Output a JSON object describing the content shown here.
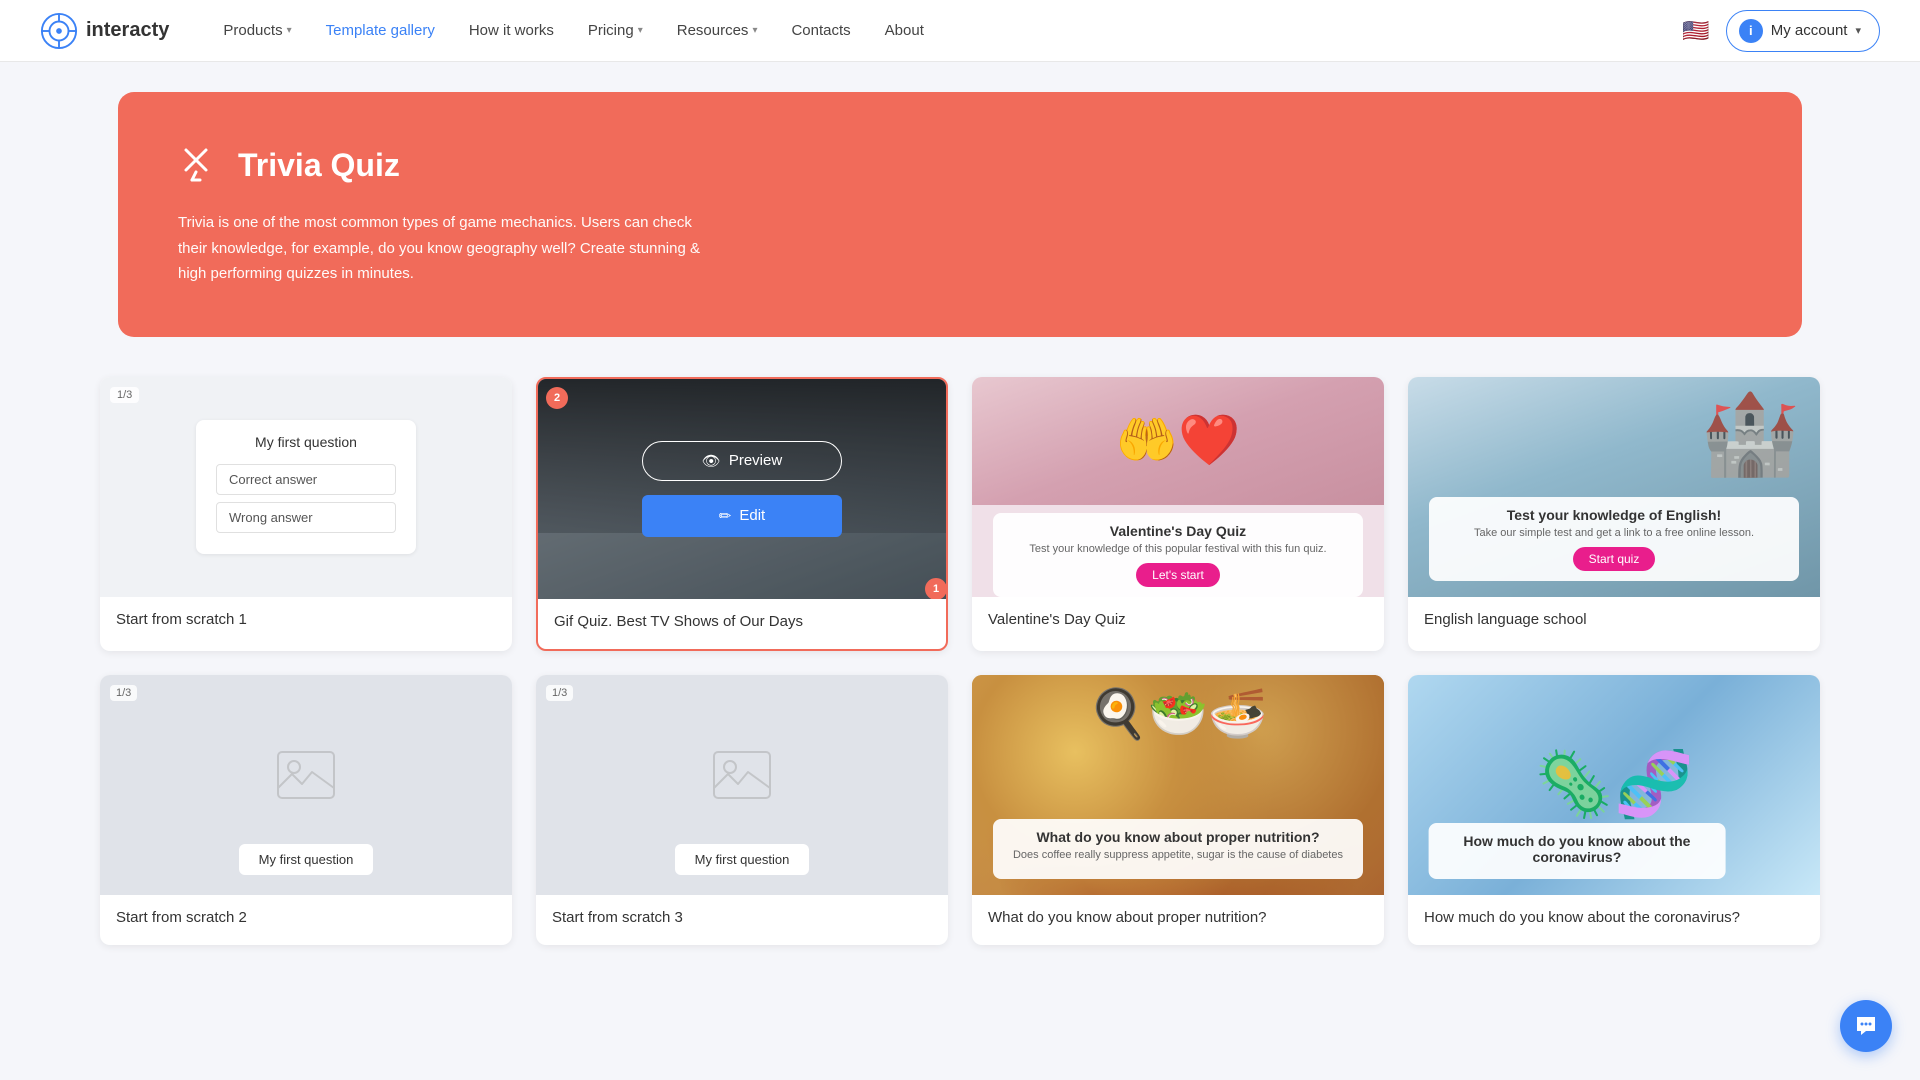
{
  "nav": {
    "logo_text": "interacty",
    "links": [
      {
        "label": "Products",
        "has_caret": true,
        "active": false
      },
      {
        "label": "Template gallery",
        "has_caret": false,
        "active": true
      },
      {
        "label": "How it works",
        "has_caret": false,
        "active": false
      },
      {
        "label": "Pricing",
        "has_caret": true,
        "active": false
      },
      {
        "label": "Resources",
        "has_caret": true,
        "active": false
      },
      {
        "label": "Contacts",
        "has_caret": false,
        "active": false
      },
      {
        "label": "About",
        "has_caret": false,
        "active": false
      }
    ],
    "my_account_label": "My account",
    "flag": "🇺🇸"
  },
  "hero": {
    "title": "Trivia Quiz",
    "description": "Trivia is one of the most common types of game mechanics. Users can check their knowledge, for example, do you know geography well? Create stunning & high performing quizzes in minutes."
  },
  "cards": [
    {
      "id": "scratch1",
      "label": "Start from scratch 1",
      "type": "scratch",
      "badge": "1/3",
      "question": "My first question",
      "answer1": "Correct answer",
      "answer2": "Wrong answer"
    },
    {
      "id": "gif-tv",
      "label": "Gif Quiz. Best TV Shows of Our Days",
      "type": "gif",
      "badge_top": "2",
      "badge_corner": "1",
      "overlay_preview_label": "Preview",
      "overlay_edit_label": "Edit"
    },
    {
      "id": "valentines",
      "label": "Valentine's Day Quiz",
      "type": "valentines",
      "card_title": "Valentine's Day Quiz",
      "card_sub": "Test your knowledge of this popular festival with this fun quiz.",
      "card_btn": "Let's start"
    },
    {
      "id": "english",
      "label": "English language school",
      "type": "english",
      "card_title": "Test your knowledge of English!",
      "card_sub": "Take our simple test and get a link to a free online lesson.",
      "card_btn": "Start quiz"
    }
  ],
  "cards2": [
    {
      "id": "scratch2",
      "label": "Start from scratch 2",
      "type": "scratch",
      "badge": "1/3",
      "question": "My first question"
    },
    {
      "id": "scratch3",
      "label": "Start from scratch 3",
      "type": "scratch",
      "badge": "1/3",
      "question": "My first question"
    },
    {
      "id": "food",
      "label": "What do you know about proper nutrition?",
      "type": "food",
      "card_title": "What do you know about proper nutrition?",
      "card_sub": "Does coffee really suppress appetite, sugar is the cause of diabetes"
    },
    {
      "id": "corona",
      "label": "How much do you know about the coronavirus?",
      "type": "corona",
      "card_title": "How much do you know about the coronavirus?"
    }
  ]
}
